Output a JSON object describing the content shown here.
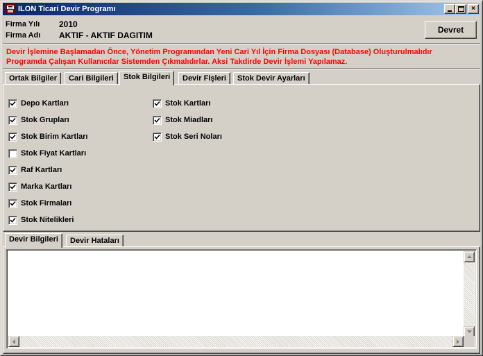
{
  "window": {
    "title": "ILON Ticari Devir Programı",
    "icon": "app-icon",
    "controls": {
      "minimize": "minimize-icon",
      "maximize": "maximize-icon",
      "close": "×"
    }
  },
  "info": {
    "year_label": "Firma Yılı",
    "year_value": "2010",
    "company_label": "Firma Adı",
    "company_value": "AKTIF - AKTIF DAGITIM"
  },
  "devret_button": "Devret",
  "warning": {
    "line1": "Devir İşlemine Başlamadan Önce, Yönetim Programından Yeni Cari Yıl İçin Firma Dosyası (Database) Oluşturulmalıdır",
    "line2": "Programda Çalışan Kullanıcılar Sistemden Çıkmalıdırlar. Aksi Takdirde Devir İşlemi Yapılamaz.",
    "color": "#ff0000"
  },
  "top_tabs": [
    {
      "label": "Ortak Bilgiler",
      "active": false
    },
    {
      "label": "Cari Bilgileri",
      "active": false
    },
    {
      "label": "Stok Bilgileri",
      "active": true
    },
    {
      "label": "Devir Fişleri",
      "active": false
    },
    {
      "label": "Stok Devir Ayarları",
      "active": false
    }
  ],
  "stok_checkboxes": {
    "col1": [
      {
        "label": "Depo Kartları",
        "checked": true
      },
      {
        "label": "Stok Grupları",
        "checked": true
      },
      {
        "label": "Stok Birim Kartları",
        "checked": true
      },
      {
        "label": "Stok Fiyat Kartları",
        "checked": false
      },
      {
        "label": "Raf Kartları",
        "checked": true
      },
      {
        "label": "Marka Kartları",
        "checked": true
      },
      {
        "label": "Stok Firmaları",
        "checked": true
      },
      {
        "label": "Stok Nitelikleri",
        "checked": true
      }
    ],
    "col2": [
      {
        "label": "Stok Kartları",
        "checked": true
      },
      {
        "label": "Stok Miadları",
        "checked": true
      },
      {
        "label": "Stok Seri Noları",
        "checked": true
      }
    ]
  },
  "bottom_tabs": [
    {
      "label": "Devir Bilgileri",
      "active": true
    },
    {
      "label": "Devir Hataları",
      "active": false
    }
  ],
  "log_text": ""
}
